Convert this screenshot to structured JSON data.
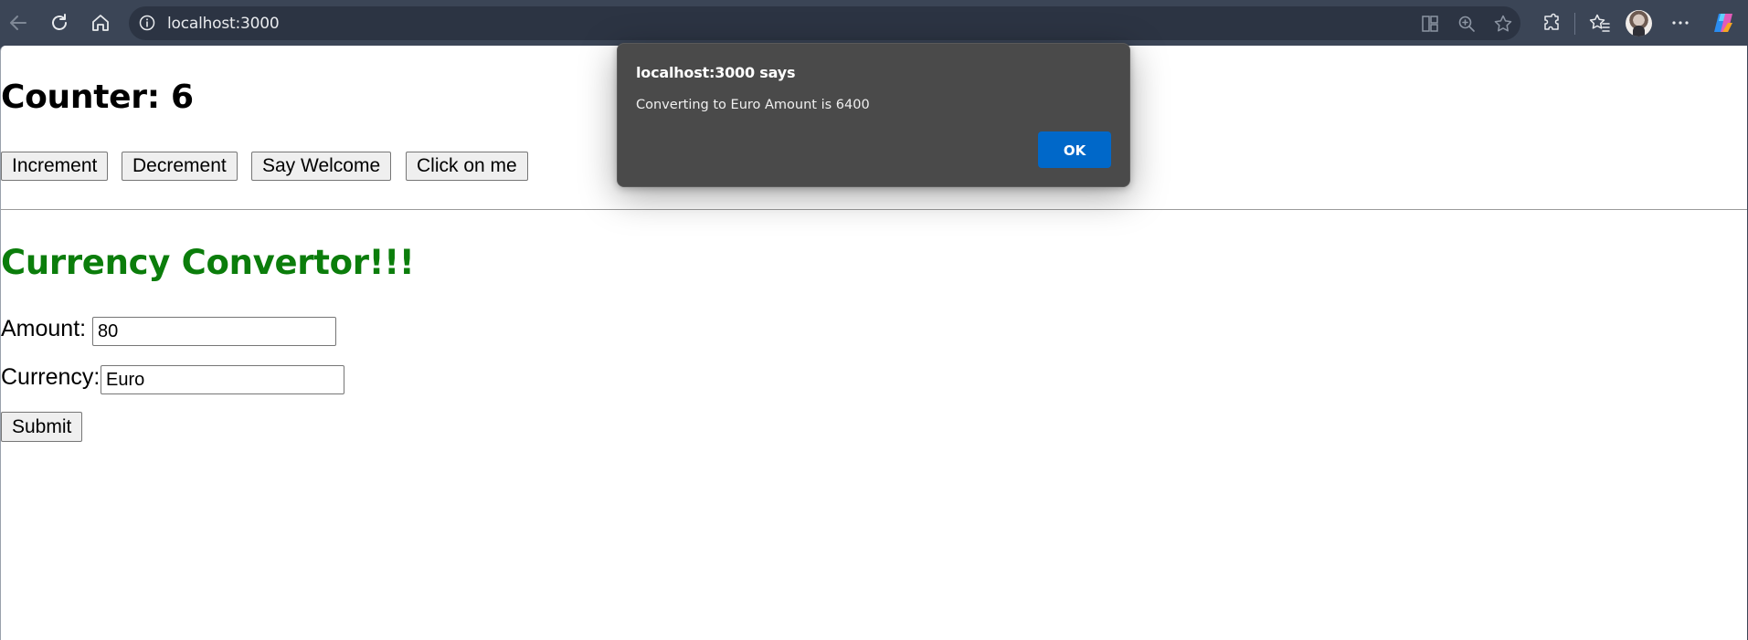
{
  "browser": {
    "url": "localhost:3000",
    "toolbar_icons": [
      "back-icon",
      "refresh-icon",
      "home-icon",
      "site-info-icon",
      "split-screen-icon",
      "zoom-icon",
      "favorite-star-icon",
      "extensions-icon",
      "favorites-icon",
      "profile-avatar",
      "more-options-icon",
      "copilot-icon"
    ],
    "colors": {
      "chrome": "#3b4556",
      "address_bar": "#2c3443"
    }
  },
  "page": {
    "counter_title": "Counter: 6",
    "buttons": {
      "increment": "Increment",
      "decrement": "Decrement",
      "say_welcome": "Say Welcome",
      "click_on_me": "Click on me"
    },
    "currency": {
      "title": "Currency Convertor!!!",
      "title_color": "#0b7d0b",
      "amount_label": "Amount:",
      "amount_value": "80",
      "currency_label": "Currency:",
      "currency_value": "Euro",
      "submit_label": "Submit"
    }
  },
  "dialog": {
    "title": "localhost:3000 says",
    "message": "Converting to Euro Amount is 6400",
    "ok_label": "OK",
    "ok_color": "#0068c9"
  }
}
